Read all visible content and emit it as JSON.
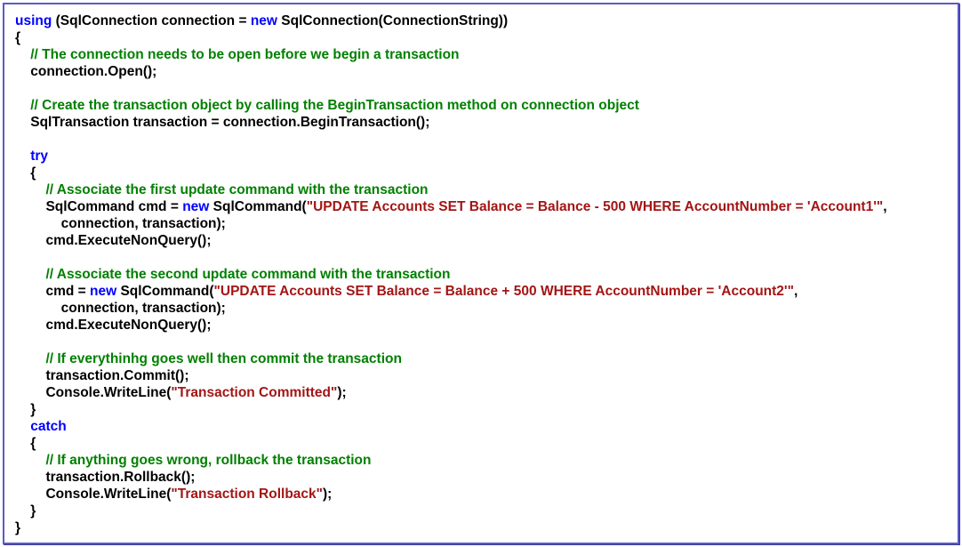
{
  "colors": {
    "keyword": "#0000ff",
    "comment": "#008000",
    "string": "#a31515",
    "text": "#000000",
    "border": "#5a5ac8"
  },
  "lines": [
    [
      {
        "t": "kw",
        "v": "using"
      },
      {
        "t": "tx",
        "v": " (SqlConnection connection = "
      },
      {
        "t": "kw",
        "v": "new"
      },
      {
        "t": "tx",
        "v": " SqlConnection(ConnectionString))"
      }
    ],
    [
      {
        "t": "tx",
        "v": "{"
      }
    ],
    [
      {
        "t": "cm",
        "v": "    // The connection needs to be open before we begin a transaction"
      }
    ],
    [
      {
        "t": "tx",
        "v": "    connection.Open();"
      }
    ],
    [],
    [
      {
        "t": "cm",
        "v": "    // Create the transaction object by calling the BeginTransaction method on connection object"
      }
    ],
    [
      {
        "t": "tx",
        "v": "    SqlTransaction transaction = connection.BeginTransaction();"
      }
    ],
    [],
    [
      {
        "t": "kw",
        "v": "    try"
      }
    ],
    [
      {
        "t": "tx",
        "v": "    {"
      }
    ],
    [
      {
        "t": "cm",
        "v": "        // Associate the first update command with the transaction"
      }
    ],
    [
      {
        "t": "tx",
        "v": "        SqlCommand cmd = "
      },
      {
        "t": "kw",
        "v": "new"
      },
      {
        "t": "tx",
        "v": " SqlCommand("
      },
      {
        "t": "st",
        "v": "\"UPDATE Accounts SET Balance = Balance - 500 WHERE AccountNumber = 'Account1'\""
      },
      {
        "t": "tx",
        "v": ","
      }
    ],
    [
      {
        "t": "tx",
        "v": "            connection, transaction);"
      }
    ],
    [
      {
        "t": "tx",
        "v": "        cmd.ExecuteNonQuery();"
      }
    ],
    [],
    [
      {
        "t": "cm",
        "v": "        // Associate the second update command with the transaction"
      }
    ],
    [
      {
        "t": "tx",
        "v": "        cmd = "
      },
      {
        "t": "kw",
        "v": "new"
      },
      {
        "t": "tx",
        "v": " SqlCommand("
      },
      {
        "t": "st",
        "v": "\"UPDATE Accounts SET Balance = Balance + 500 WHERE AccountNumber = 'Account2'\""
      },
      {
        "t": "tx",
        "v": ","
      }
    ],
    [
      {
        "t": "tx",
        "v": "            connection, transaction);"
      }
    ],
    [
      {
        "t": "tx",
        "v": "        cmd.ExecuteNonQuery();"
      }
    ],
    [],
    [
      {
        "t": "cm",
        "v": "        // If everythinhg goes well then commit the transaction"
      }
    ],
    [
      {
        "t": "tx",
        "v": "        transaction.Commit();"
      }
    ],
    [
      {
        "t": "tx",
        "v": "        Console.WriteLine("
      },
      {
        "t": "st",
        "v": "\"Transaction Committed\""
      },
      {
        "t": "tx",
        "v": ");"
      }
    ],
    [
      {
        "t": "tx",
        "v": "    }"
      }
    ],
    [
      {
        "t": "kw",
        "v": "    catch"
      }
    ],
    [
      {
        "t": "tx",
        "v": "    {"
      }
    ],
    [
      {
        "t": "cm",
        "v": "        // If anything goes wrong, rollback the transaction"
      }
    ],
    [
      {
        "t": "tx",
        "v": "        transaction.Rollback();"
      }
    ],
    [
      {
        "t": "tx",
        "v": "        Console.WriteLine("
      },
      {
        "t": "st",
        "v": "\"Transaction Rollback\""
      },
      {
        "t": "tx",
        "v": ");"
      }
    ],
    [
      {
        "t": "tx",
        "v": "    }"
      }
    ],
    [
      {
        "t": "tx",
        "v": "}"
      }
    ]
  ]
}
